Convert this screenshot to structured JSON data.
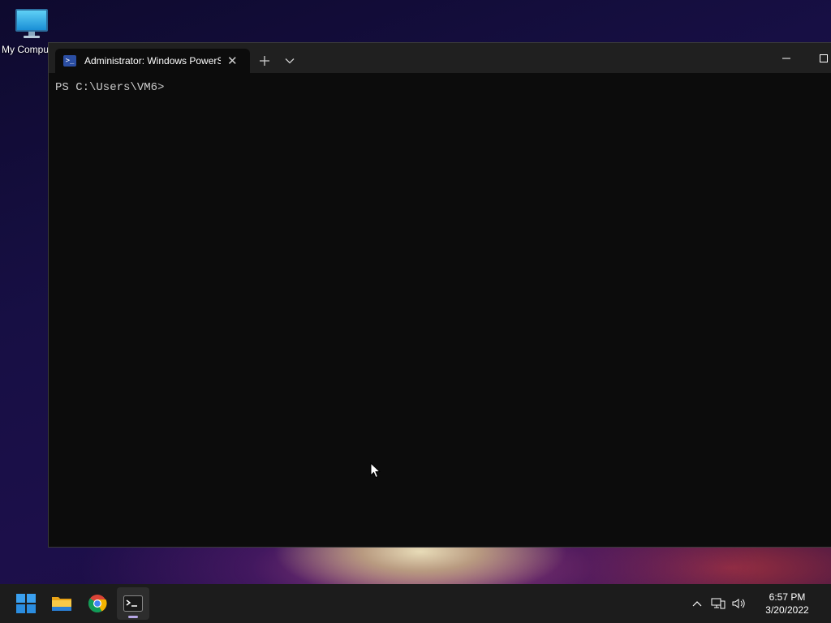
{
  "desktop": {
    "icons": [
      {
        "label": "My Compu",
        "icon": "computer-monitor-icon"
      }
    ]
  },
  "window": {
    "tab": {
      "title": "Administrator: Windows PowerS",
      "icon": "powershell-icon"
    },
    "terminal": {
      "lines": [
        "PS C:\\Users\\VM6>"
      ]
    }
  },
  "taskbar": {
    "apps": [
      {
        "name": "start",
        "icon": "windows-start-icon"
      },
      {
        "name": "file-explorer",
        "icon": "folder-icon"
      },
      {
        "name": "chrome",
        "icon": "chrome-icon"
      },
      {
        "name": "terminal",
        "icon": "terminal-icon",
        "active": true
      }
    ],
    "clock": {
      "time": "6:57 PM",
      "date": "3/20/2022"
    }
  },
  "colors": {
    "terminal_bg": "#0c0c0c",
    "titlebar_bg": "#202020",
    "taskbar_bg": "#1c1c1c",
    "active_indicator": "#b7a7e6"
  }
}
